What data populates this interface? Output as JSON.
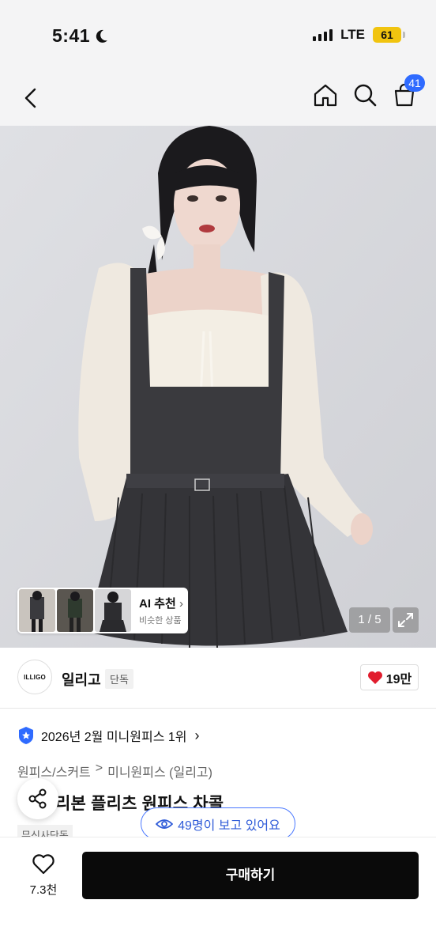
{
  "status_bar": {
    "time": "5:41",
    "network": "LTE",
    "battery": "61"
  },
  "nav": {
    "cart_count": "41"
  },
  "hero": {
    "ai_recommend": {
      "title": "AI 추천",
      "subtitle": "비슷한 상품"
    },
    "page_indicator": "1 / 5"
  },
  "brand": {
    "logo_text": "ILLIGO",
    "name": "일리고",
    "exclusive_label": "단독",
    "likes": "19만"
  },
  "ranking": {
    "text": "2026년 2월 미니원피스 1위"
  },
  "breadcrumb": [
    "원피스/스커트",
    ">",
    "미니원피스 (일리고)"
  ],
  "product": {
    "title": "리본 플리츠 원피스 차콜",
    "tag": "무신사단독"
  },
  "viewers": {
    "text": "49명이 보고 있어요"
  },
  "bottom": {
    "wish_count": "7.3천",
    "buy_label": "구매하기"
  },
  "colors": {
    "accent": "#2f6bff",
    "heart": "#e11d2e",
    "battery": "#f1c40f"
  }
}
